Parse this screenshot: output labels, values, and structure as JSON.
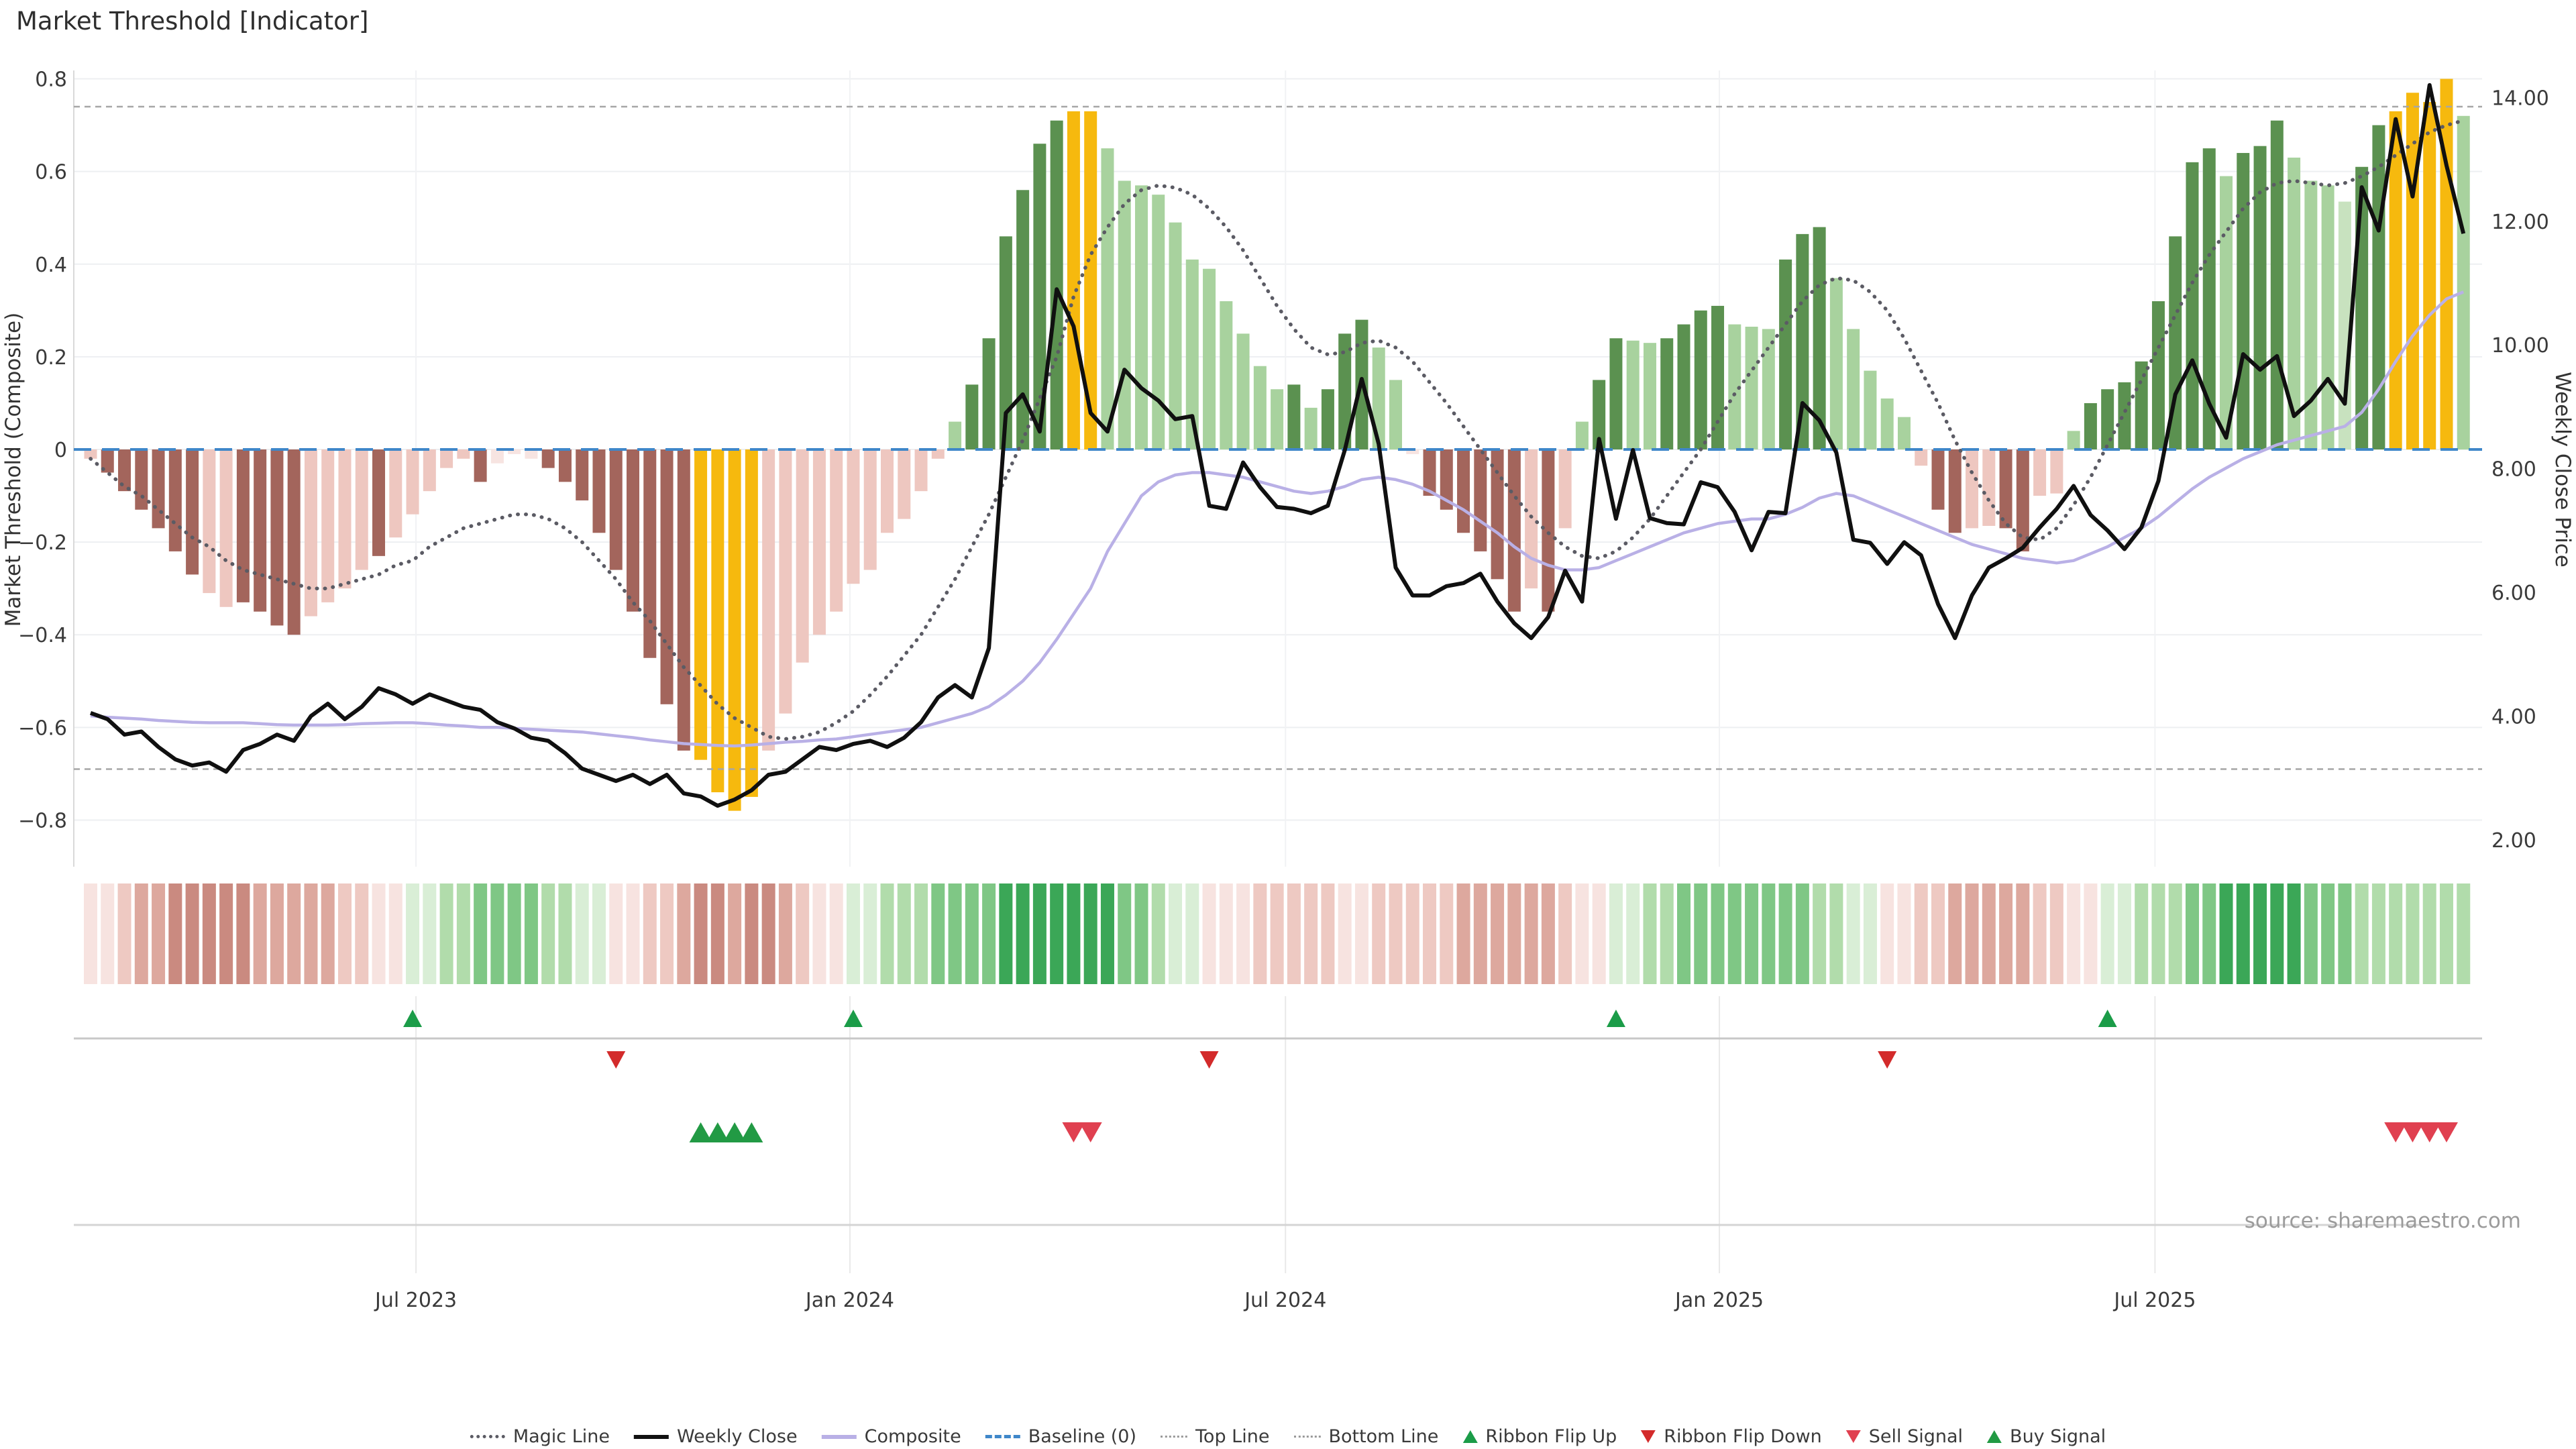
{
  "title": "Market Threshold [Indicator]",
  "source": "source: sharemaestro.com",
  "axes": {
    "left_label": "Market Threshold (Composite)",
    "right_label": "Weekly Close Price",
    "left_ticks": [
      {
        "label": "0.8",
        "value": 0.8
      },
      {
        "label": "0.6",
        "value": 0.6
      },
      {
        "label": "0.4",
        "value": 0.4
      },
      {
        "label": "0.2",
        "value": 0.2
      },
      {
        "label": "0",
        "value": 0.0
      },
      {
        "label": "−0.2",
        "value": -0.2
      },
      {
        "label": "−0.4",
        "value": -0.4
      },
      {
        "label": "−0.6",
        "value": -0.6
      },
      {
        "label": "−0.8",
        "value": -0.8
      }
    ],
    "right_ticks": [
      {
        "label": "14.00",
        "value": 14
      },
      {
        "label": "12.00",
        "value": 12
      },
      {
        "label": "10.00",
        "value": 10
      },
      {
        "label": "8.00",
        "value": 8
      },
      {
        "label": "6.00",
        "value": 6
      },
      {
        "label": "4.00",
        "value": 4
      },
      {
        "label": "2.00",
        "value": 2
      }
    ],
    "x_ticks": [
      {
        "label": "Jul 2023",
        "week": 20.2
      },
      {
        "label": "Jan 2024",
        "week": 45.8
      },
      {
        "label": "Jul 2024",
        "week": 71.5
      },
      {
        "label": "Jan 2025",
        "week": 97.1
      },
      {
        "label": "Jul 2025",
        "week": 122.8
      }
    ]
  },
  "legend": {
    "items": [
      {
        "label": "Magic Line",
        "swatch": "dotted-line",
        "color": "#5b5b64"
      },
      {
        "label": "Weekly Close",
        "swatch": "solid-line",
        "color": "#111111"
      },
      {
        "label": "Composite",
        "swatch": "solid-line",
        "color": "#b9b0e6"
      },
      {
        "label": "Baseline (0)",
        "swatch": "dashed-line",
        "color": "#3f87c9"
      },
      {
        "label": "Top Line",
        "swatch": "fine-dotted-line",
        "color": "#9a9a9a"
      },
      {
        "label": "Bottom Line",
        "swatch": "fine-dotted-line",
        "color": "#9a9a9a"
      },
      {
        "label": "Ribbon Flip Up",
        "swatch": "triangle-up",
        "color": "#1b9c48"
      },
      {
        "label": "Ribbon Flip Down",
        "swatch": "triangle-down",
        "color": "#d32b2b"
      },
      {
        "label": "Sell Signal",
        "swatch": "triangle-down",
        "color": "#e04050"
      },
      {
        "label": "Buy Signal",
        "swatch": "triangle-up",
        "color": "#229a44"
      }
    ]
  },
  "chart_data": {
    "type": "bar",
    "weeks": 141,
    "ylim_left": [
      -0.9,
      0.88
    ],
    "ylim_right": [
      2,
      14
    ],
    "axis_alignment": [
      {
        "price": 14,
        "composite": 0.7597
      },
      {
        "price": 2,
        "composite": -0.8425
      }
    ],
    "baselines": {
      "baseline": 0.0,
      "top_line": 0.74,
      "bottom_line": -0.69
    },
    "bar_palette": {
      "dr": "#a3655c",
      "lp": "#eec7c0",
      "vlp": "#f7e4e1",
      "g": "#f6b90e",
      "lg": "#a8d29e",
      "vlg": "#c8e2bf",
      "dg": "#5b9150"
    },
    "composite_histogram": [
      -0.02,
      -0.05,
      -0.09,
      -0.13,
      -0.17,
      -0.22,
      -0.27,
      -0.31,
      -0.34,
      -0.33,
      -0.35,
      -0.38,
      -0.4,
      -0.36,
      -0.33,
      -0.3,
      -0.26,
      -0.23,
      -0.19,
      -0.14,
      -0.09,
      -0.04,
      -0.02,
      -0.07,
      -0.03,
      -0.01,
      -0.02,
      -0.04,
      -0.07,
      -0.11,
      -0.18,
      -0.26,
      -0.35,
      -0.45,
      -0.55,
      -0.65,
      -0.67,
      -0.74,
      -0.78,
      -0.75,
      -0.65,
      -0.57,
      -0.46,
      -0.4,
      -0.35,
      -0.29,
      -0.26,
      -0.18,
      -0.15,
      -0.09,
      -0.02,
      0.06,
      0.14,
      0.24,
      0.46,
      0.56,
      0.66,
      0.71,
      0.73,
      0.73,
      0.65,
      0.58,
      0.57,
      0.55,
      0.49,
      0.41,
      0.39,
      0.32,
      0.25,
      0.18,
      0.13,
      0.14,
      0.09,
      0.13,
      0.25,
      0.28,
      0.22,
      0.15,
      -0.01,
      -0.1,
      -0.13,
      -0.18,
      -0.22,
      -0.28,
      -0.35,
      -0.3,
      -0.35,
      -0.17,
      0.06,
      0.15,
      0.24,
      0.235,
      0.23,
      0.24,
      0.27,
      0.3,
      0.31,
      0.27,
      0.265,
      0.26,
      0.41,
      0.465,
      0.48,
      0.37,
      0.26,
      0.17,
      0.11,
      0.07,
      -0.035,
      -0.13,
      -0.18,
      -0.17,
      -0.165,
      -0.17,
      -0.22,
      -0.1,
      -0.095,
      0.04,
      0.1,
      0.13,
      0.145,
      0.19,
      0.32,
      0.46,
      0.62,
      0.65,
      0.59,
      0.64,
      0.655,
      0.71,
      0.63,
      0.58,
      0.57,
      0.535,
      0.61,
      0.7,
      0.73,
      0.77,
      0.75,
      0.8,
      0.72
    ],
    "bar_colors": [
      "lp",
      "dr",
      "dr",
      "dr",
      "dr",
      "dr",
      "dr",
      "lp",
      "lp",
      "dr",
      "dr",
      "dr",
      "dr",
      "lp",
      "lp",
      "lp",
      "lp",
      "dr",
      "lp",
      "lp",
      "lp",
      "lp",
      "lp",
      "dr",
      "vlp",
      "vlp",
      "vlp",
      "dr",
      "dr",
      "dr",
      "dr",
      "dr",
      "dr",
      "dr",
      "dr",
      "dr",
      "g",
      "g",
      "g",
      "g",
      "lp",
      "lp",
      "lp",
      "lp",
      "lp",
      "lp",
      "lp",
      "lp",
      "lp",
      "lp",
      "lp",
      "lg",
      "dg",
      "dg",
      "dg",
      "dg",
      "dg",
      "dg",
      "g",
      "g",
      "lg",
      "lg",
      "lg",
      "lg",
      "lg",
      "lg",
      "lg",
      "lg",
      "lg",
      "lg",
      "lg",
      "dg",
      "lg",
      "dg",
      "dg",
      "dg",
      "lg",
      "lg",
      "vlp",
      "dr",
      "dr",
      "dr",
      "dr",
      "dr",
      "dr",
      "lp",
      "dr",
      "lp",
      "lg",
      "dg",
      "dg",
      "lg",
      "lg",
      "dg",
      "dg",
      "dg",
      "dg",
      "lg",
      "lg",
      "lg",
      "dg",
      "dg",
      "dg",
      "lg",
      "lg",
      "lg",
      "lg",
      "lg",
      "lp",
      "dr",
      "dr",
      "lp",
      "lp",
      "dr",
      "dr",
      "lp",
      "lp",
      "lg",
      "dg",
      "dg",
      "dg",
      "dg",
      "dg",
      "dg",
      "dg",
      "dg",
      "lg",
      "dg",
      "dg",
      "dg",
      "lg",
      "lg",
      "lg",
      "vlg",
      "dg",
      "dg",
      "g",
      "g",
      "g",
      "g",
      "lg"
    ],
    "weekly_close": [
      4.05,
      3.95,
      3.7,
      3.75,
      3.5,
      3.3,
      3.2,
      3.25,
      3.1,
      3.45,
      3.55,
      3.7,
      3.6,
      4.0,
      4.2,
      3.95,
      4.15,
      4.45,
      4.35,
      4.2,
      4.35,
      4.25,
      4.15,
      4.1,
      3.9,
      3.8,
      3.65,
      3.6,
      3.4,
      3.15,
      3.05,
      2.95,
      3.05,
      2.9,
      3.05,
      2.75,
      2.7,
      2.55,
      2.65,
      2.8,
      3.05,
      3.1,
      3.3,
      3.5,
      3.45,
      3.55,
      3.6,
      3.5,
      3.65,
      3.9,
      4.3,
      4.5,
      4.3,
      5.1,
      8.9,
      9.2,
      8.6,
      10.9,
      10.3,
      8.9,
      8.6,
      9.6,
      9.3,
      9.1,
      8.8,
      8.85,
      7.4,
      7.35,
      8.1,
      7.7,
      7.38,
      7.35,
      7.28,
      7.4,
      8.3,
      9.45,
      8.4,
      6.4,
      5.95,
      5.95,
      6.1,
      6.15,
      6.3,
      5.85,
      5.5,
      5.26,
      5.6,
      6.35,
      5.85,
      8.48,
      7.19,
      8.3,
      7.2,
      7.12,
      7.1,
      7.78,
      7.7,
      7.3,
      6.68,
      7.3,
      7.28,
      9.06,
      8.78,
      8.26,
      6.85,
      6.8,
      6.46,
      6.81,
      6.6,
      5.81,
      5.26,
      5.95,
      6.4,
      6.55,
      6.72,
      7.05,
      7.35,
      7.72,
      7.25,
      7.0,
      6.7,
      7.05,
      7.8,
      9.2,
      9.75,
      9.05,
      8.5,
      9.85,
      9.6,
      9.82,
      8.85,
      9.1,
      9.45,
      9.05,
      12.55,
      11.85,
      13.65,
      12.4,
      14.2,
      12.9,
      11.8
    ],
    "magic_line": [
      -0.02,
      -0.05,
      -0.08,
      -0.1,
      -0.13,
      -0.16,
      -0.19,
      -0.21,
      -0.24,
      -0.26,
      -0.27,
      -0.28,
      -0.29,
      -0.3,
      -0.3,
      -0.29,
      -0.28,
      -0.27,
      -0.25,
      -0.24,
      -0.21,
      -0.19,
      -0.17,
      -0.16,
      -0.15,
      -0.14,
      -0.14,
      -0.15,
      -0.17,
      -0.2,
      -0.24,
      -0.28,
      -0.33,
      -0.37,
      -0.42,
      -0.47,
      -0.51,
      -0.55,
      -0.58,
      -0.6,
      -0.62,
      -0.625,
      -0.62,
      -0.61,
      -0.59,
      -0.565,
      -0.53,
      -0.49,
      -0.445,
      -0.4,
      -0.34,
      -0.28,
      -0.21,
      -0.14,
      -0.06,
      0.02,
      0.11,
      0.2,
      0.33,
      0.42,
      0.48,
      0.53,
      0.56,
      0.57,
      0.565,
      0.55,
      0.52,
      0.48,
      0.43,
      0.37,
      0.31,
      0.26,
      0.22,
      0.205,
      0.21,
      0.23,
      0.235,
      0.22,
      0.19,
      0.145,
      0.1,
      0.05,
      0.0,
      -0.05,
      -0.1,
      -0.145,
      -0.18,
      -0.21,
      -0.23,
      -0.235,
      -0.22,
      -0.19,
      -0.15,
      -0.1,
      -0.05,
      0.0,
      0.06,
      0.12,
      0.17,
      0.22,
      0.27,
      0.32,
      0.355,
      0.37,
      0.365,
      0.34,
      0.3,
      0.24,
      0.17,
      0.1,
      0.02,
      -0.05,
      -0.11,
      -0.16,
      -0.19,
      -0.195,
      -0.17,
      -0.12,
      -0.06,
      0.01,
      0.08,
      0.15,
      0.22,
      0.29,
      0.36,
      0.42,
      0.47,
      0.52,
      0.555,
      0.575,
      0.58,
      0.575,
      0.57,
      0.575,
      0.59,
      0.61,
      0.635,
      0.66,
      0.685,
      0.7,
      0.71
    ],
    "composite_line": [
      -0.575,
      -0.578,
      -0.58,
      -0.582,
      -0.585,
      -0.587,
      -0.589,
      -0.59,
      -0.59,
      -0.59,
      -0.592,
      -0.594,
      -0.595,
      -0.595,
      -0.595,
      -0.594,
      -0.592,
      -0.591,
      -0.59,
      -0.59,
      -0.592,
      -0.595,
      -0.597,
      -0.6,
      -0.6,
      -0.602,
      -0.604,
      -0.606,
      -0.608,
      -0.61,
      -0.614,
      -0.618,
      -0.622,
      -0.627,
      -0.631,
      -0.635,
      -0.637,
      -0.639,
      -0.64,
      -0.638,
      -0.635,
      -0.632,
      -0.63,
      -0.627,
      -0.625,
      -0.62,
      -0.615,
      -0.61,
      -0.605,
      -0.6,
      -0.59,
      -0.58,
      -0.57,
      -0.555,
      -0.53,
      -0.5,
      -0.46,
      -0.41,
      -0.355,
      -0.3,
      -0.22,
      -0.16,
      -0.1,
      -0.07,
      -0.055,
      -0.05,
      -0.05,
      -0.055,
      -0.06,
      -0.07,
      -0.08,
      -0.09,
      -0.095,
      -0.09,
      -0.08,
      -0.065,
      -0.06,
      -0.065,
      -0.075,
      -0.09,
      -0.11,
      -0.13,
      -0.155,
      -0.18,
      -0.21,
      -0.235,
      -0.25,
      -0.26,
      -0.26,
      -0.255,
      -0.24,
      -0.225,
      -0.21,
      -0.195,
      -0.18,
      -0.17,
      -0.16,
      -0.155,
      -0.15,
      -0.15,
      -0.14,
      -0.125,
      -0.105,
      -0.095,
      -0.1,
      -0.115,
      -0.13,
      -0.145,
      -0.16,
      -0.175,
      -0.19,
      -0.205,
      -0.215,
      -0.225,
      -0.235,
      -0.24,
      -0.245,
      -0.24,
      -0.225,
      -0.21,
      -0.19,
      -0.17,
      -0.145,
      -0.115,
      -0.085,
      -0.06,
      -0.04,
      -0.02,
      -0.005,
      0.01,
      0.02,
      0.03,
      0.04,
      0.05,
      0.08,
      0.13,
      0.19,
      0.245,
      0.29,
      0.325,
      0.34
    ],
    "ribbon": {
      "palette": {
        "r1": "#f7e3e0",
        "r2": "#eec9c2",
        "r3": "#dda89e",
        "r4": "#ca8a80",
        "g1": "#d9eed6",
        "g2": "#b1dcab",
        "g3": "#7fc785",
        "g4": "#3ba757"
      },
      "colors": [
        "r1",
        "r1",
        "r2",
        "r3",
        "r3",
        "r4",
        "r4",
        "r4",
        "r4",
        "r4",
        "r3",
        "r3",
        "r3",
        "r3",
        "r3",
        "r2",
        "r2",
        "r1",
        "r1",
        "g1",
        "g1",
        "g2",
        "g2",
        "g3",
        "g3",
        "g3",
        "g3",
        "g2",
        "g2",
        "g1",
        "g1",
        "r1",
        "r1",
        "r2",
        "r2",
        "r3",
        "r4",
        "r4",
        "r3",
        "r4",
        "r4",
        "r3",
        "r2",
        "r1",
        "r1",
        "g1",
        "g1",
        "g2",
        "g2",
        "g2",
        "g3",
        "g3",
        "g3",
        "g3",
        "g4",
        "g4",
        "g4",
        "g4",
        "g4",
        "g4",
        "g4",
        "g3",
        "g3",
        "g2",
        "g1",
        "g1",
        "r1",
        "r1",
        "r1",
        "r2",
        "r2",
        "r2",
        "r2",
        "r2",
        "r1",
        "r1",
        "r2",
        "r2",
        "r2",
        "r2",
        "r2",
        "r3",
        "r3",
        "r3",
        "r3",
        "r3",
        "r3",
        "r2",
        "r1",
        "r1",
        "g1",
        "g1",
        "g2",
        "g2",
        "g3",
        "g3",
        "g3",
        "g3",
        "g3",
        "g3",
        "g3",
        "g3",
        "g2",
        "g2",
        "g1",
        "g1",
        "r1",
        "r1",
        "r2",
        "r2",
        "r3",
        "r3",
        "r3",
        "r3",
        "r3",
        "r2",
        "r2",
        "r1",
        "r1",
        "g1",
        "g1",
        "g2",
        "g2",
        "g2",
        "g3",
        "g3",
        "g4",
        "g4",
        "g4",
        "g4",
        "g4",
        "g3",
        "g3",
        "g3",
        "g2",
        "g2",
        "g2",
        "g2",
        "g2",
        "g2",
        "g2"
      ]
    },
    "signals": {
      "ribbon_flip_up_weeks": [
        20,
        46,
        91,
        120
      ],
      "ribbon_flip_down_weeks": [
        32,
        67,
        107
      ],
      "buy_signal_weeks": [
        37,
        38,
        39,
        40
      ],
      "sell_signal_weeks": [
        59,
        60,
        137,
        138,
        139,
        140
      ],
      "colors": {
        "flip_up": "#1b9c48",
        "flip_down": "#d32b2b",
        "buy": "#229a44",
        "sell": "#e04050"
      }
    },
    "style_colors": {
      "weekly_close": "#101010",
      "magic_line": "#5b5b64",
      "composite_line": "#b9b0e6",
      "baseline": "#3f87c9",
      "top_bottom": "#a6a6a6",
      "grid": "#edeff2",
      "spine": "#d9d9d9",
      "separator": "#c8c8c8",
      "tick_text": "#3a3a3a"
    }
  }
}
